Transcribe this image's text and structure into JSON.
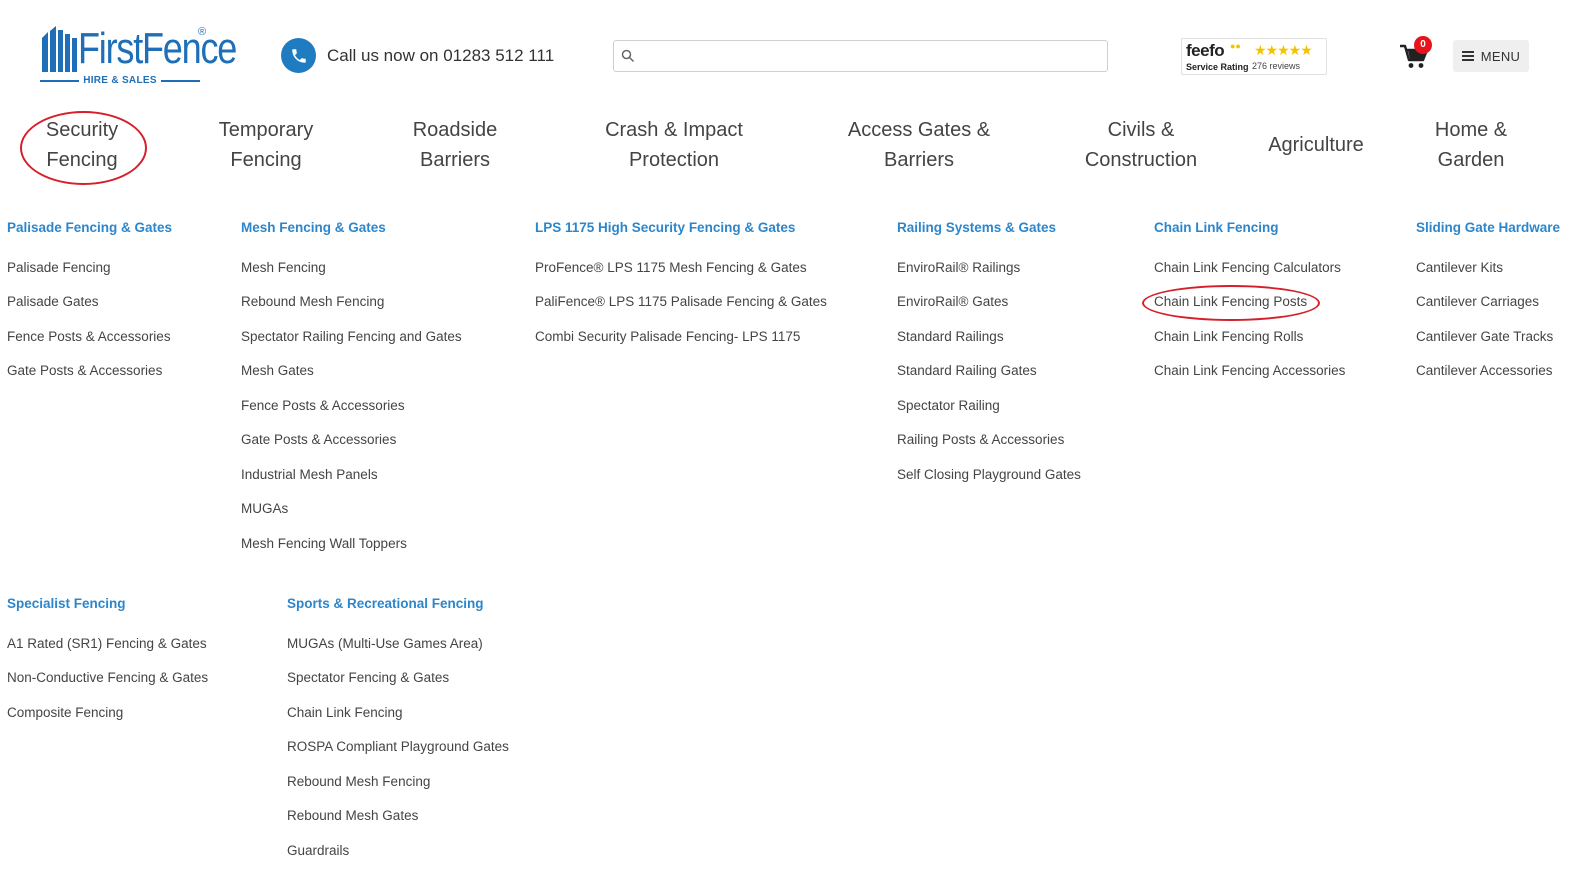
{
  "brand": {
    "name": "FirstFence",
    "subtitle": "HIRE & SALES",
    "mark": "®",
    "color": "#1e6fb8"
  },
  "header": {
    "phone_text": "Call us now on 01283 512 111",
    "search": {
      "value": "",
      "placeholder": ""
    },
    "feefo": {
      "name": "feefo",
      "stars": "★★★★★",
      "rating_label": "Service Rating",
      "reviews": "276 reviews"
    },
    "cart_count": "0",
    "menu_label": "MENU"
  },
  "nav": [
    {
      "line1": "Security",
      "line2": "Fencing"
    },
    {
      "line1": "Temporary",
      "line2": "Fencing"
    },
    {
      "line1": "Roadside",
      "line2": "Barriers"
    },
    {
      "line1": "Crash & Impact",
      "line2": "Protection"
    },
    {
      "line1": "Access Gates &",
      "line2": "Barriers"
    },
    {
      "line1": "Civils &",
      "line2": "Construction"
    },
    {
      "line1": "Agriculture",
      "line2": ""
    },
    {
      "line1": "Home &",
      "line2": "Garden"
    }
  ],
  "megamenu": {
    "palisade": {
      "title": "Palisade Fencing & Gates",
      "items": [
        "Palisade Fencing",
        "Palisade Gates",
        "Fence Posts & Accessories",
        "Gate Posts & Accessories"
      ]
    },
    "mesh": {
      "title": "Mesh Fencing & Gates",
      "items": [
        "Mesh Fencing",
        "Rebound Mesh Fencing",
        "Spectator Railing Fencing and Gates",
        "Mesh Gates",
        "Fence Posts & Accessories",
        "Gate Posts & Accessories",
        "Industrial Mesh Panels",
        "MUGAs",
        "Mesh Fencing Wall Toppers"
      ]
    },
    "lps": {
      "title": "LPS 1175 High Security Fencing & Gates",
      "items": [
        "ProFence® LPS 1175 Mesh Fencing & Gates",
        "PaliFence® LPS 1175 Palisade Fencing & Gates",
        "Combi Security Palisade Fencing- LPS 1175"
      ]
    },
    "railing": {
      "title": "Railing Systems & Gates",
      "items": [
        "EnviroRail® Railings",
        "EnviroRail® Gates",
        "Standard Railings",
        "Standard Railing Gates",
        "Spectator Railing",
        "Railing Posts & Accessories",
        "Self Closing Playground Gates"
      ]
    },
    "chainlink": {
      "title": "Chain Link Fencing",
      "items": [
        "Chain Link Fencing Calculators",
        "Chain Link Fencing Posts",
        "Chain Link Fencing Rolls",
        "Chain Link Fencing Accessories"
      ]
    },
    "sliding": {
      "title": "Sliding Gate Hardware",
      "items": [
        "Cantilever Kits",
        "Cantilever Carriages",
        "Cantilever Gate Tracks",
        "Cantilever Accessories"
      ]
    },
    "specialist": {
      "title": "Specialist Fencing",
      "items": [
        "A1 Rated (SR1) Fencing & Gates",
        "Non-Conductive Fencing & Gates",
        "Composite Fencing"
      ]
    },
    "sports": {
      "title": "Sports & Recreational Fencing",
      "items": [
        "MUGAs (Multi-Use Games Area)",
        "Spectator Fencing & Gates",
        "Chain Link Fencing",
        "ROSPA Compliant Playground Gates",
        "Rebound Mesh Fencing",
        "Rebound Mesh Gates",
        "Guardrails"
      ]
    }
  },
  "colors": {
    "link_title": "#2c86cc",
    "highlight_circle": "#d51f2a",
    "phone_icon": "#1f7cc0",
    "cart_badge": "#e8141b"
  }
}
